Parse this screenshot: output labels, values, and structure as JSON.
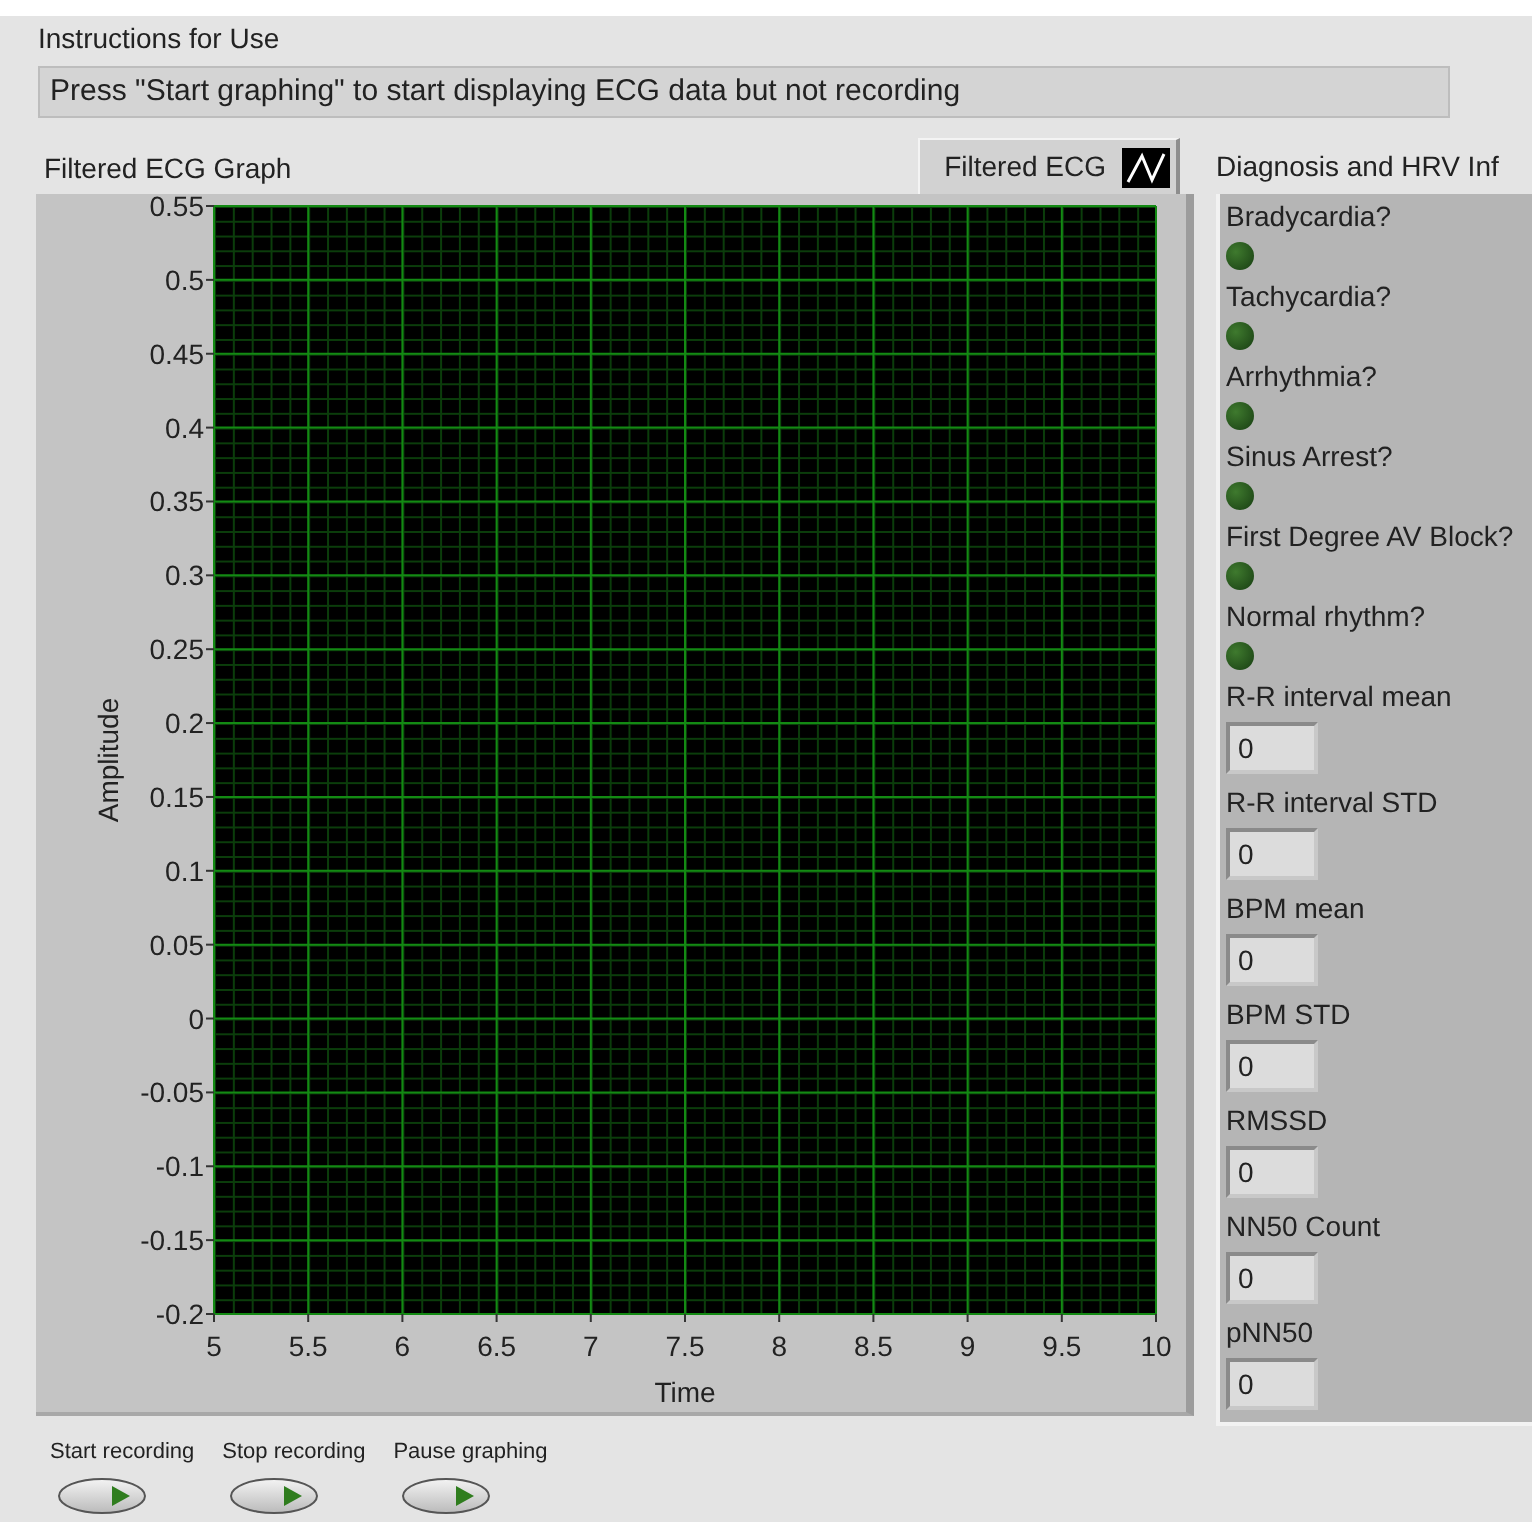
{
  "instructions": {
    "label": "Instructions for Use",
    "value": "Press \"Start graphing\" to start displaying ECG data but not recording"
  },
  "graph": {
    "legend": "Filtered ECG",
    "chart_data": {
      "type": "line",
      "grid": true,
      "title": "Filtered ECG Graph",
      "xlabel": "Time",
      "ylabel": "Amplitude",
      "xlim": [
        5,
        10
      ],
      "ylim": [
        -0.2,
        0.55
      ],
      "xticks": [
        5,
        5.5,
        6,
        6.5,
        7,
        7.5,
        8,
        8.5,
        9,
        9.5,
        10
      ],
      "yticks": [
        0.55,
        0.5,
        0.45,
        0.4,
        0.35,
        0.3,
        0.25,
        0.2,
        0.15,
        0.1,
        0.05,
        0,
        -0.05,
        -0.1,
        -0.15,
        -0.2
      ]
    }
  },
  "diagnosis": {
    "title": "Diagnosis and HRV Inf",
    "items": [
      {
        "kind": "led",
        "label": "Bradycardia?",
        "on": false
      },
      {
        "kind": "led",
        "label": "Tachycardia?",
        "on": false
      },
      {
        "kind": "led",
        "label": "Arrhythmia?",
        "on": false
      },
      {
        "kind": "led",
        "label": "Sinus Arrest?",
        "on": false
      },
      {
        "kind": "led",
        "label": "First Degree AV Block?",
        "on": false
      },
      {
        "kind": "led",
        "label": "Normal rhythm?",
        "on": false
      },
      {
        "kind": "numeric",
        "label": "R-R interval mean",
        "value": "0"
      },
      {
        "kind": "numeric",
        "label": "R-R interval STD",
        "value": "0"
      },
      {
        "kind": "numeric",
        "label": "BPM mean",
        "value": "0"
      },
      {
        "kind": "numeric",
        "label": "BPM STD",
        "value": "0"
      },
      {
        "kind": "numeric",
        "label": "RMSSD",
        "value": "0"
      },
      {
        "kind": "numeric",
        "label": "NN50 Count",
        "value": "0"
      },
      {
        "kind": "numeric",
        "label": "pNN50",
        "value": "0"
      }
    ]
  },
  "buttons": [
    {
      "label": "Start recording"
    },
    {
      "label": "Stop recording"
    },
    {
      "label": "Pause graphing"
    }
  ]
}
